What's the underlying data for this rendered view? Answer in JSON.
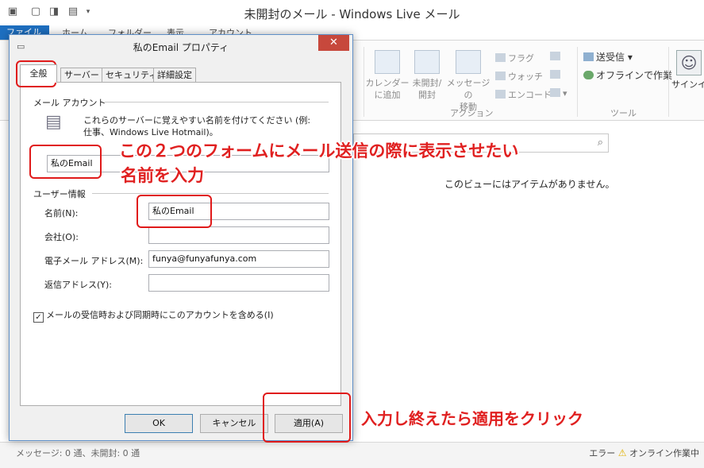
{
  "window": {
    "title": "未開封のメール - Windows Live メール"
  },
  "ribbon": {
    "tabs": [
      "ファイル",
      "ホーム",
      "フォルダー",
      "表示",
      "アカウント"
    ],
    "calendar": "カレンダー\nに追加",
    "unread_read": "未開封/\n開封",
    "move_message": "メッセージの\n移動",
    "flag": "フラグ",
    "watch": "ウォッチ",
    "encode": "エンコード",
    "action_group": "アクション",
    "send_receive": "送受信",
    "offline": "オフラインで作業",
    "tools_group": "ツール",
    "signin": "サインイ"
  },
  "mail_list": {
    "empty_message": "このビューにはアイテムがありません。"
  },
  "status": {
    "left": "メッセージ: 0 通、未開封: 0 通",
    "error": "エラー",
    "right": "オンライン作業中"
  },
  "dialog": {
    "title": "私のEmail プロパティ",
    "close": "✕",
    "tabs": [
      "全般",
      "サーバー",
      "セキュリティ",
      "詳細設定"
    ],
    "mail_account_section": "メール アカウント",
    "intro": "これらのサーバーに覚えやすい名前を付けてください (例: 仕事、Windows Live Hotmail)。",
    "account_name": "私のEmail",
    "user_info_section": "ユーザー情報",
    "fields": {
      "name_label": "名前(N):",
      "name_value": "私のEmail",
      "company_label": "会社(O):",
      "company_value": "",
      "email_label": "電子メール アドレス(M):",
      "email_value": "funya@funyafunya.com",
      "reply_label": "返信アドレス(Y):",
      "reply_value": ""
    },
    "include_checkbox": "メールの受信時および同期時にこのアカウントを含める(I)",
    "buttons": {
      "ok": "OK",
      "cancel": "キャンセル",
      "apply": "適用(A)"
    }
  },
  "annotations": {
    "line1": "この２つのフォームにメール送信の際に表示させたい",
    "line2": "名前を入力",
    "apply_note": "入力し終えたら適用をクリック"
  },
  "colors": {
    "annotation": "#e02020",
    "file_tab": "#1e6fc0",
    "close_button": "#c7483c"
  }
}
